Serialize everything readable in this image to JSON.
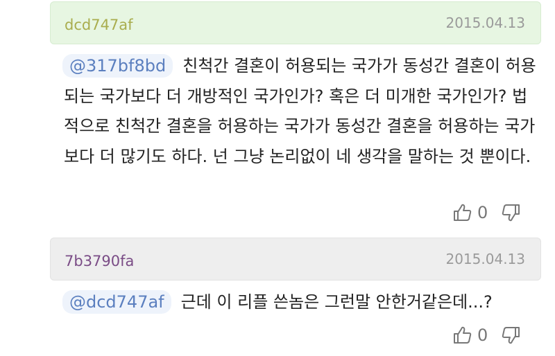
{
  "comments": [
    {
      "author": "dcd747af",
      "author_color": "#a9ad4e",
      "date": "2015.04.13",
      "mention": "@317bf8bd",
      "text": "친척간 결혼이 허용되는 국가가 동성간 결혼이 허용되는 국가보다 더 개방적인 국가인가? 혹은 더 미개한 국가인가? 법적으로 친척간 결혼을 허용하는 국가가 동성간 결혼을 허용하는 국가보다 더 많기도 하다. 넌 그냥 논리없이 네 생각을 말하는 것 뿐이다.",
      "likes": "0"
    },
    {
      "author": "7b3790fa",
      "author_color": "#7a4c86",
      "date": "2015.04.13",
      "mention": "@dcd747af",
      "text": "근데 이 리플 쓴놈은 그런말 안한거같은데...?",
      "likes": "0"
    }
  ],
  "icons": {
    "like": "thumbs-up-icon",
    "dislike": "thumbs-down-icon"
  },
  "colors": {
    "header_green": "#e7f6e2",
    "header_gray": "#eeeeee",
    "mention_bg": "#eef3fb",
    "mention_text": "#5b7fbf"
  }
}
